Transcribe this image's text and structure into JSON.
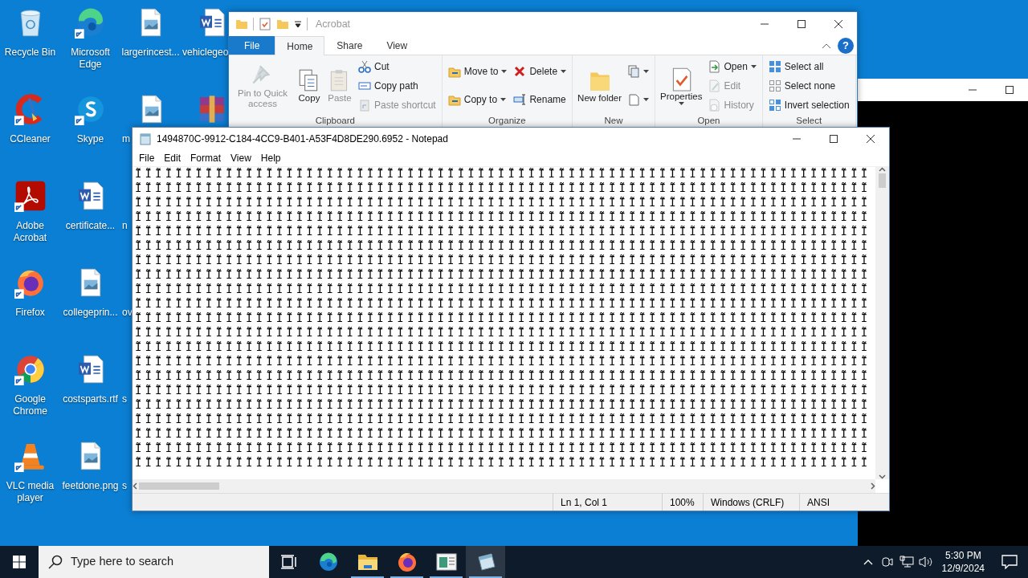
{
  "desktop": {
    "rows": [
      [
        {
          "label": "Recycle Bin",
          "kind": "recycle-bin",
          "shortcut": false
        },
        {
          "label": "Microsoft Edge",
          "kind": "edge",
          "shortcut": true
        },
        {
          "label": "largerincest...",
          "kind": "image-file",
          "shortcut": false
        },
        {
          "label": "vehiclegeo",
          "kind": "word-file",
          "shortcut": false
        }
      ],
      [
        {
          "label": "CCleaner",
          "kind": "ccleaner",
          "shortcut": true
        },
        {
          "label": "Skype",
          "kind": "skype",
          "shortcut": true
        },
        {
          "label": "m",
          "kind": "image-file",
          "shortcut": false
        },
        {
          "kind": "archive",
          "shortcut": false
        }
      ],
      [
        {
          "label": "Adobe Acrobat",
          "kind": "acrobat",
          "shortcut": true
        },
        {
          "label": "certificate...",
          "kind": "word-file",
          "shortcut": false
        },
        {
          "label": "n"
        }
      ],
      [
        {
          "label": "Firefox",
          "kind": "firefox",
          "shortcut": true
        },
        {
          "label": "collegeprin...",
          "kind": "image-file",
          "shortcut": false
        },
        {
          "label": "ov"
        }
      ],
      [
        {
          "label": "Google Chrome",
          "kind": "chrome",
          "shortcut": true
        },
        {
          "label": "costsparts.rtf",
          "kind": "word-file",
          "shortcut": false
        },
        {
          "label": "s"
        }
      ],
      [
        {
          "label": "VLC media player",
          "kind": "vlc",
          "shortcut": true
        },
        {
          "label": "feetdone.png",
          "kind": "image-file",
          "shortcut": false
        },
        {
          "label": "s"
        }
      ]
    ]
  },
  "explorer": {
    "title": "Acrobat",
    "tabs": [
      {
        "label": "File",
        "kind": "file",
        "selected": false
      },
      {
        "label": "Home",
        "kind": "tab",
        "selected": true
      },
      {
        "label": "Share",
        "kind": "tab",
        "selected": false
      },
      {
        "label": "View",
        "kind": "tab",
        "selected": false
      }
    ],
    "help": "?",
    "groups": [
      {
        "label": "Clipboard",
        "columns": [
          [
            {
              "label": "Pin to Quick access",
              "kind": "pin",
              "disabled": true,
              "dropdown": false
            }
          ],
          [
            {
              "label": "Copy",
              "kind": "copy",
              "disabled": false,
              "dropdown": false
            }
          ],
          [
            {
              "label": "Paste",
              "kind": "paste",
              "disabled": true,
              "dropdown": false
            }
          ],
          [
            {
              "label": "Cut",
              "kind": "cut",
              "disabled": false,
              "dropdown": false
            },
            {
              "label": "Copy path",
              "kind": "copy-path",
              "disabled": false,
              "dropdown": false
            },
            {
              "label": "Paste shortcut",
              "kind": "paste-shortcut",
              "disabled": true,
              "dropdown": false
            }
          ]
        ]
      },
      {
        "label": "Organize",
        "columns": [
          [
            {
              "label": "Move to",
              "kind": "move-to",
              "disabled": false,
              "dropdown": true
            },
            {
              "label": "Copy to",
              "kind": "copy-to",
              "disabled": false,
              "dropdown": true
            }
          ],
          [
            {
              "label": "Delete",
              "kind": "delete",
              "disabled": false,
              "dropdown": true
            },
            {
              "label": "Rename",
              "kind": "rename",
              "disabled": false,
              "dropdown": false
            }
          ]
        ]
      },
      {
        "label": "New",
        "columns": [
          [
            {
              "label": "New folder",
              "kind": "folder",
              "disabled": false,
              "dropdown": false
            }
          ],
          [
            {
              "kind": "new-item",
              "disabled": false,
              "dropdown": true
            },
            {
              "kind": "easy-access",
              "disabled": false,
              "dropdown": true
            }
          ]
        ]
      },
      {
        "label": "Open",
        "columns": [
          [
            {
              "label": "Properties",
              "kind": "properties",
              "disabled": false,
              "dropdown": true
            }
          ],
          [
            {
              "label": "Open",
              "kind": "open",
              "disabled": false,
              "dropdown": true
            },
            {
              "label": "Edit",
              "kind": "edit",
              "disabled": true,
              "dropdown": false
            },
            {
              "label": "History",
              "kind": "history",
              "disabled": true,
              "dropdown": false
            }
          ]
        ]
      },
      {
        "label": "Select",
        "columns": [
          [
            {
              "label": "Select all",
              "kind": "select-all",
              "disabled": false,
              "dropdown": false
            },
            {
              "label": "Select none",
              "kind": "select-none",
              "disabled": false,
              "dropdown": false
            },
            {
              "label": "Invert selection",
              "kind": "invert",
              "disabled": false,
              "dropdown": false
            }
          ]
        ]
      }
    ]
  },
  "notepad": {
    "title": "1494870C-9912-C184-4CC9-B401-A53F4D8DE290.6952 - Notepad",
    "menu": [
      "File",
      "Edit",
      "Format",
      "View",
      "Help"
    ],
    "lines": [
      "ĨĨĨĨĨĨĨĨĨĨĨĨĨĨĨĨĨĨĨĨĨĨĨĨĨĨĨĨĨĨĨĨĨĨĨĨĨĨĨĨĨĨĨĨĨĨĨĨĨĨĨĨĨĨĨĨĨĨĨĨĨĨĨĨĨĨĨĨĨĨĨĨĨ",
      "ĨĨĨĨĨĨĨĨĨĨĨĨĨĨĨĨĨĨĨĨĨĨĨĨĨĨĨĨĨĨĨĨĨĨĨĨĨĨĨĨĨĨĨĨĨĨĨĨĨĨĨĨĨĨĨĨĨĨĨĨĨĨĨĨĨĨĨĨĨĨĨĨĨ",
      "ĨĨĨĨĨĨĨĨĨĨĨĨĨĨĨĨĨĨĨĨĨĨĨĨĨĨĨĨĨĨĨĨĨĨĨĨĨĨĨĨĨĨĨĨĨĨĨĨĨĨĨĨĨĨĨĨĨĨĨĨĨĨĨĨĨĨĨĨĨĨĨĨĨ",
      "ĨĨĨĨĨĨĨĨĨĨĨĨĨĨĨĨĨĨĨĨĨĨĨĨĨĨĨĨĨĨĨĨĨĨĨĨĨĨĨĨĨĨĨĨĨĨĨĨĨĨĨĨĨĨĨĨĨĨĨĨĨĨĨĨĨĨĨĨĨĨĨĨĨ",
      "ĨĨĨĨĨĨĨĨĨĨĨĨĨĨĨĨĨĨĨĨĨĨĨĨĨĨĨĨĨĨĨĨĨĨĨĨĨĨĨĨĨĨĨĨĨĨĨĨĨĨĨĨĨĨĨĨĨĨĨĨĨĨĨĨĨĨĨĨĨĨĨĨĨ",
      "ĨĨĨĨĨĨĨĨĨĨĨĨĨĨĨĨĨĨĨĨĨĨĨĨĨĨĨĨĨĨĨĨĨĨĨĨĨĨĨĨĨĨĨĨĨĨĨĨĨĨĨĨĨĨĨĨĨĨĨĨĨĨĨĨĨĨĨĨĨĨĨĨĨ",
      "ĨĨĨĨĨĨĨĨĨĨĨĨĨĨĨĨĨĨĨĨĨĨĨĨĨĨĨĨĨĨĨĨĨĨĨĨĨĨĨĨĨĨĨĨĨĨĨĨĨĨĨĨĨĨĨĨĨĨĨĨĨĨĨĨĨĨĨĨĨĨĨĨĨ",
      "ĨĨĨĨĨĨĨĨĨĨĨĨĨĨĨĨĨĨĨĨĨĨĨĨĨĨĨĨĨĨĨĨĨĨĨĨĨĨĨĨĨĨĨĨĨĨĨĨĨĨĨĨĨĨĨĨĨĨĨĨĨĨĨĨĨĨĨĨĨĨĨĨĨ",
      "ĨĨĨĨĨĨĨĨĨĨĨĨĨĨĨĨĨĨĨĨĨĨĨĨĨĨĨĨĨĨĨĨĨĨĨĨĨĨĨĨĨĨĨĨĨĨĨĨĨĨĨĨĨĨĨĨĨĨĨĨĨĨĨĨĨĨĨĨĨĨĨĨĨ",
      "ĨĨĨĨĨĨĨĨĨĨĨĨĨĨĨĨĨĨĨĨĨĨĨĨĨĨĨĨĨĨĨĨĨĨĨĨĨĨĨĨĨĨĨĨĨĨĨĨĨĨĨĨĨĨĨĨĨĨĨĨĨĨĨĨĨĨĨĨĨĨĨĨĨ",
      "ĨĨĨĨĨĨĨĨĨĨĨĨĨĨĨĨĨĨĨĨĨĨĨĨĨĨĨĨĨĨĨĨĨĨĨĨĨĨĨĨĨĨĨĨĨĨĨĨĨĨĨĨĨĨĨĨĨĨĨĨĨĨĨĨĨĨĨĨĨĨĨĨĨ",
      "ĨĨĨĨĨĨĨĨĨĨĨĨĨĨĨĨĨĨĨĨĨĨĨĨĨĨĨĨĨĨĨĨĨĨĨĨĨĨĨĨĨĨĨĨĨĨĨĨĨĨĨĨĨĨĨĨĨĨĨĨĨĨĨĨĨĨĨĨĨĨĨĨĨ",
      "ĨĨĨĨĨĨĨĨĨĨĨĨĨĨĨĨĨĨĨĨĨĨĨĨĨĨĨĨĨĨĨĨĨĨĨĨĨĨĨĨĨĨĨĨĨĨĨĨĨĨĨĨĨĨĨĨĨĨĨĨĨĨĨĨĨĨĨĨĨĨĨĨĨ",
      "ĨĨĨĨĨĨĨĨĨĨĨĨĨĨĨĨĨĨĨĨĨĨĨĨĨĨĨĨĨĨĨĨĨĨĨĨĨĨĨĨĨĨĨĨĨĨĨĨĨĨĨĨĨĨĨĨĨĨĨĨĨĨĨĨĨĨĨĨĨĨĨĨĨ",
      "ĨĨĨĨĨĨĨĨĨĨĨĨĨĨĨĨĨĨĨĨĨĨĨĨĨĨĨĨĨĨĨĨĨĨĨĨĨĨĨĨĨĨĨĨĨĨĨĨĨĨĨĨĨĨĨĨĨĨĨĨĨĨĨĨĨĨĨĨĨĨĨĨĨ",
      "ĨĨĨĨĨĨĨĨĨĨĨĨĨĨĨĨĨĨĨĨĨĨĨĨĨĨĨĨĨĨĨĨĨĨĨĨĨĨĨĨĨĨĨĨĨĨĨĨĨĨĨĨĨĨĨĨĨĨĨĨĨĨĨĨĨĨĨĨĨĨĨĨĨ",
      "ĨĨĨĨĨĨĨĨĨĨĨĨĨĨĨĨĨĨĨĨĨĨĨĨĨĨĨĨĨĨĨĨĨĨĨĨĨĨĨĨĨĨĨĨĨĨĨĨĨĨĨĨĨĨĨĨĨĨĨĨĨĨĨĨĨĨĨĨĨĨĨĨĨ",
      "ĨĨĨĨĨĨĨĨĨĨĨĨĨĨĨĨĨĨĨĨĨĨĨĨĨĨĨĨĨĨĨĨĨĨĨĨĨĨĨĨĨĨĨĨĨĨĨĨĨĨĨĨĨĨĨĨĨĨĨĨĨĨĨĨĨĨĨĨĨĨĨĨĨ",
      "ĨĨĨĨĨĨĨĨĨĨĨĨĨĨĨĨĨĨĨĨĨĨĨĨĨĨĨĨĨĨĨĨĨĨĨĨĨĨĨĨĨĨĨĨĨĨĨĨĨĨĨĨĨĨĨĨĨĨĨĨĨĨĨĨĨĨĨĨĨĨĨĨĨ",
      "ĨĨĨĨĨĨĨĨĨĨĨĨĨĨĨĨĨĨĨĨĨĨĨĨĨĨĨĨĨĨĨĨĨĨĨĨĨĨĨĨĨĨĨĨĨĨĨĨĨĨĨĨĨĨĨĨĨĨĨĨĨĨĨĨĨĨĨĨĨĨĨĨĨ",
      "ĨĨĨĨĨĨĨĨĨĨĨĨĨĨĨĨĨĨĨĨĨĨĨĨĨĨĨĨĨĨĨĨĨĨĨĨĨĨĨĨĨĨĨĨĨĨĨĨĨĨĨĨĨĨĨĨĨĨĨĨĨĨĨĨĨĨĨĨĨĨĨĨĨ"
    ],
    "status": [
      "Ln 1, Col 1",
      "100%",
      "Windows (CRLF)",
      "ANSI"
    ]
  },
  "taskbar": {
    "search": {
      "placeholder": "Type here to search"
    },
    "apps": [
      {
        "kind": "task-view",
        "running": false,
        "active": false
      },
      {
        "kind": "edge",
        "running": false,
        "active": false
      },
      {
        "kind": "explorer",
        "running": true,
        "active": false
      },
      {
        "kind": "firefox",
        "running": true,
        "active": false
      },
      {
        "kind": "app",
        "running": true,
        "active": false
      },
      {
        "kind": "notepad",
        "running": true,
        "active": true
      }
    ],
    "time": "5:30 PM",
    "date": "12/9/2024"
  }
}
